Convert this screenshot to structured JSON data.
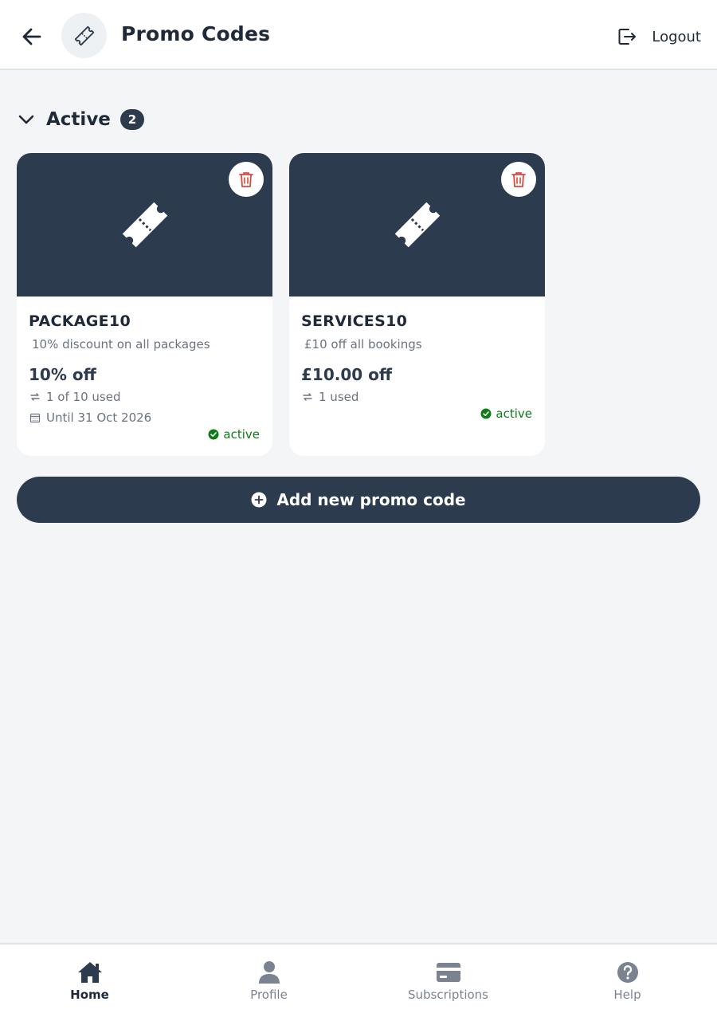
{
  "header": {
    "title": "Promo Codes",
    "logout_label": "Logout"
  },
  "section": {
    "title": "Active",
    "count": "2"
  },
  "promo_codes": [
    {
      "code": "PACKAGE10",
      "description": "10% discount on all packages",
      "value": "10% off",
      "usage": "1 of 10 used",
      "until": "Until 31 Oct 2026",
      "status": "active"
    },
    {
      "code": "SERVICES10",
      "description": "£10 off all bookings",
      "value": "£10.00 off",
      "usage": "1 used",
      "status": "active"
    }
  ],
  "add_button": {
    "label": "Add new promo code"
  },
  "nav": {
    "items": [
      {
        "label": "Home",
        "icon": "home-icon",
        "active": true
      },
      {
        "label": "Profile",
        "icon": "person-icon"
      },
      {
        "label": "Subscriptions",
        "icon": "card-icon"
      },
      {
        "label": "Help",
        "icon": "help-icon"
      }
    ]
  },
  "colors": {
    "primary": "#2d3b4e",
    "background": "#f3f5f7",
    "delete": "#d9473b",
    "active_status": "#0e7a18",
    "muted_text": "#6b7280"
  }
}
